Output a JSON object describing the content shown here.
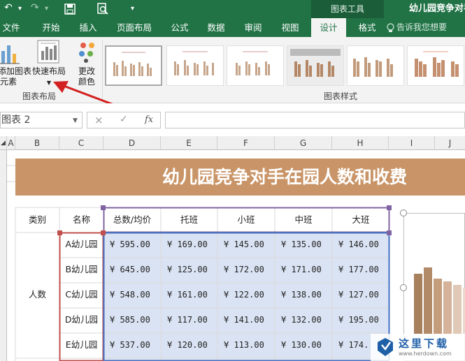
{
  "titlebar": {
    "window_title": "幼儿园竞争对手",
    "context_tab": "图表工具"
  },
  "tabs": [
    {
      "label": "文件"
    },
    {
      "label": "开始"
    },
    {
      "label": "插入"
    },
    {
      "label": "页面布局"
    },
    {
      "label": "公式"
    },
    {
      "label": "数据"
    },
    {
      "label": "审阅"
    },
    {
      "label": "视图"
    },
    {
      "label": "设计"
    },
    {
      "label": "格式"
    }
  ],
  "tellme": "告诉我您想要",
  "ribbon": {
    "add_element_line1": "添加图表",
    "add_element_line2": "元素",
    "quick_layout": "快速布局",
    "change_colors_line1": "更改",
    "change_colors_line2": "颜色",
    "group_layouts": "图表布局",
    "group_styles": "图表样式"
  },
  "formula_bar": {
    "name_box": "图表 2",
    "fx": "fx",
    "cancel": "×",
    "enter": "✓"
  },
  "columns": [
    "A",
    "B",
    "C",
    "D",
    "E",
    "F",
    "G",
    "H",
    "I",
    "J"
  ],
  "sheet": {
    "banner_title": "幼儿园竞争对手在园人数和收费",
    "headers": [
      "类别",
      "名称",
      "总数/均价",
      "托班",
      "小班",
      "中班",
      "大班"
    ],
    "category": "人数",
    "rows": [
      {
        "name": "A幼儿园",
        "vals": [
          "¥ 595.00",
          "¥ 169.00",
          "¥ 145.00",
          "¥ 135.00",
          "¥ 146.00"
        ]
      },
      {
        "name": "B幼儿园",
        "vals": [
          "¥ 645.00",
          "¥ 125.00",
          "¥ 172.00",
          "¥ 171.00",
          "¥ 177.00"
        ]
      },
      {
        "name": "C幼儿园",
        "vals": [
          "¥ 548.00",
          "¥ 161.00",
          "¥ 122.00",
          "¥ 138.00",
          "¥ 127.00"
        ]
      },
      {
        "name": "D幼儿园",
        "vals": [
          "¥ 585.00",
          "¥ 117.00",
          "¥ 141.00",
          "¥ 132.00",
          "¥ 195.00"
        ]
      },
      {
        "name": "E幼儿园",
        "vals": [
          "¥ 537.00",
          "¥ 120.00",
          "¥ 113.00",
          "¥ 130.00",
          "¥ 174."
        ]
      }
    ]
  },
  "chart_preview": {
    "bars": [
      {
        "value": 0.78,
        "color": "#a9805e"
      },
      {
        "value": 0.86,
        "color": "#b38a67"
      },
      {
        "value": 0.72,
        "color": "#c49d7c"
      },
      {
        "value": 0.68,
        "color": "#d4b39a"
      },
      {
        "value": 0.64,
        "color": "#e0c9b6"
      },
      {
        "value": 0.6,
        "color": "#ead9cb"
      }
    ]
  },
  "watermark": {
    "text": "这里下载",
    "url": "www.herdown.com"
  },
  "colors": {
    "excel_green": "#217346",
    "banner": "#c99568",
    "grid": "#d9d9d9",
    "highlight_red": "#c0504d",
    "highlight_purple": "#8064a2",
    "highlight_blue": "#dae3f3"
  }
}
